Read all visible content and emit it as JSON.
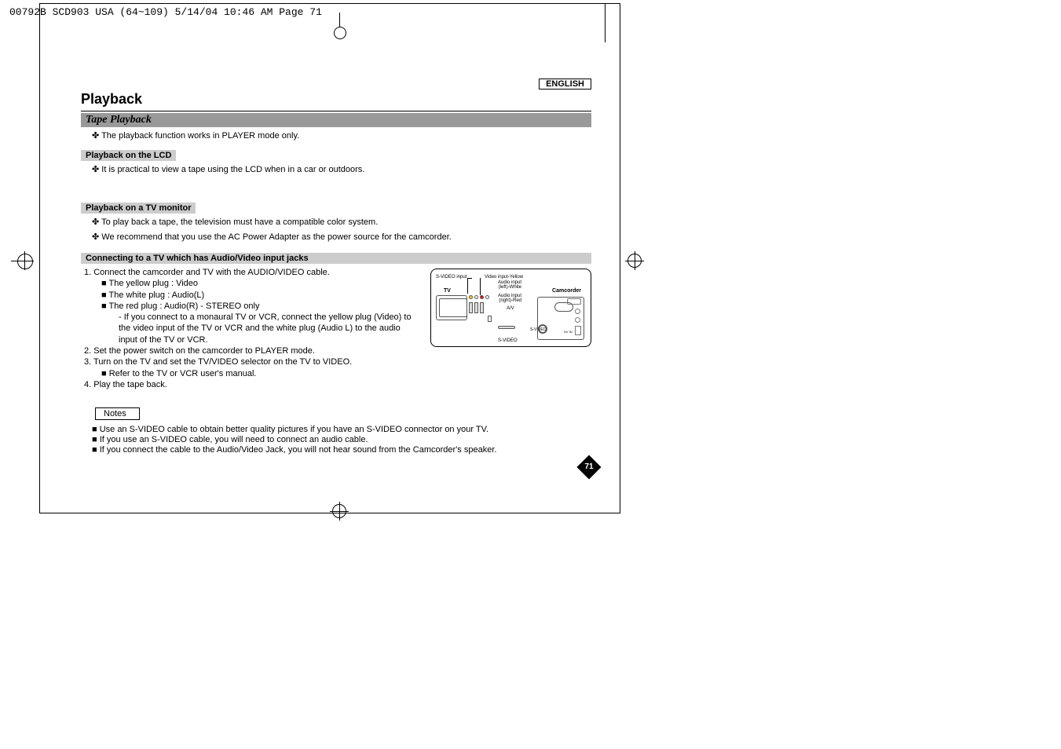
{
  "print_header": "00792B SCD903 USA (64~109)  5/14/04 10:46 AM  Page 71",
  "language": "ENGLISH",
  "title": "Playback",
  "section": "Tape Playback",
  "intro_bullet": "✤  The playback function works in PLAYER mode only.",
  "lcd": {
    "heading": "Playback on the LCD",
    "bullet": "✤  It is practical to view a tape using the LCD when in a car or outdoors."
  },
  "tv": {
    "heading": "Playback on a TV monitor",
    "b1": "✤  To play back a tape, the television must have a compatible color system.",
    "b2": "✤  We recommend that you use the AC Power Adapter as the power source for the camcorder."
  },
  "connecting": {
    "heading": "Connecting to a TV which has Audio/Video input jacks",
    "step1": "1.  Connect the camcorder and TV with the AUDIO/VIDEO cable.",
    "step1a": "■  The yellow plug : Video",
    "step1b": "■  The white plug : Audio(L)",
    "step1c": "■  The red plug : Audio(R) - STEREO only",
    "step1c_sub": "-   If you connect to a monaural TV or VCR, connect the yellow plug (Video) to the video input of the TV or VCR and the white plug (Audio L) to the audio input of the TV or VCR.",
    "step2": "2.  Set the power switch on the camcorder to PLAYER mode.",
    "step3": "3.  Turn on the TV and set the TV/VIDEO selector on the TV to VIDEO.",
    "step3a": "■  Refer to the TV or VCR user's manual.",
    "step4": "4.  Play the tape back."
  },
  "notes": {
    "label": "Notes",
    "n1": "■  Use an S-VIDEO cable to obtain better quality pictures if you have an S-VIDEO connector on your TV.",
    "n2": "■  If you use an S-VIDEO cable, you will need to connect an audio cable.",
    "n3": "■  If you connect the cable to the Audio/Video Jack, you will not hear sound from the Camcorder's speaker."
  },
  "diagram": {
    "tv": "TV",
    "camcorder": "Camcorder",
    "svideo_input": "S-VIDEO input",
    "video_input": "Video input-Yellow",
    "audio_l": "Audio input (left)-White",
    "audio_r": "Audio input (right)-Red",
    "av": "A/V",
    "svideo": "S-VIDEO",
    "svideo_r": "S-VIDEO",
    "dvin": "DV IN"
  },
  "page_number": "71"
}
